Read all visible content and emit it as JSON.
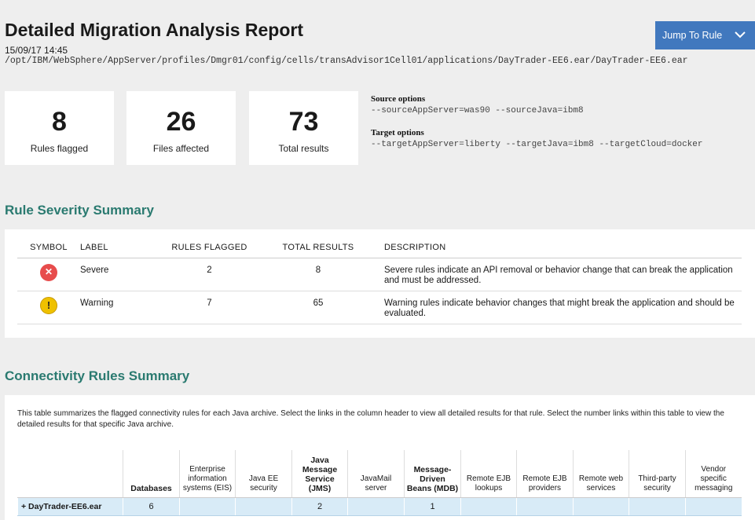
{
  "header": {
    "title": "Detailed Migration Analysis Report",
    "timestamp": "15/09/17 14:45",
    "path": "/opt/IBM/WebSphere/AppServer/profiles/Dmgr01/config/cells/transAdvisor1Cell01/applications/DayTrader-EE6.ear/DayTrader-EE6.ear",
    "jump_button_label": "Jump To Rule"
  },
  "stats": [
    {
      "value": "8",
      "label": "Rules flagged"
    },
    {
      "value": "26",
      "label": "Files affected"
    },
    {
      "value": "73",
      "label": "Total results"
    }
  ],
  "options": {
    "source_header": "Source options",
    "source_value": "--sourceAppServer=was90 --sourceJava=ibm8",
    "target_header": "Target options",
    "target_value": "--targetAppServer=liberty --targetJava=ibm8 --targetCloud=docker"
  },
  "severity_summary": {
    "title": "Rule Severity Summary",
    "columns": [
      "SYMBOL",
      "LABEL",
      "RULES FLAGGED",
      "TOTAL RESULTS",
      "DESCRIPTION"
    ],
    "rows": [
      {
        "symbol": "✕",
        "label": "Severe",
        "rules_flagged": "2",
        "total_results": "8",
        "description": "Severe rules indicate an API removal or behavior change that can break the application and must be addressed."
      },
      {
        "symbol": "!",
        "label": "Warning",
        "rules_flagged": "7",
        "total_results": "65",
        "description": "Warning rules indicate behavior changes that might break the application and should be evaluated."
      }
    ],
    "colors": {
      "severe": "#e74c4c",
      "warning": "#efc100"
    }
  },
  "connectivity_summary": {
    "title": "Connectivity Rules Summary",
    "description": "This table summarizes the flagged connectivity rules for each Java archive. Select the links in the column header to view all detailed results for that rule. Select the number links within this table to view the detailed results for that specific Java archive.",
    "columns": [
      "",
      "Databases",
      "Enterprise information systems (EIS)",
      "Java EE security",
      "Java Message Service (JMS)",
      "JavaMail server",
      "Message-Driven Beans (MDB)",
      "Remote EJB lookups",
      "Remote EJB providers",
      "Remote web services",
      "Third-party security",
      "Vendor specific messaging"
    ],
    "rows": [
      {
        "archive": "+ DayTrader-EE6.ear",
        "values": [
          "6",
          "",
          "",
          "2",
          "",
          "1",
          "",
          "",
          "",
          "",
          ""
        ]
      }
    ]
  },
  "colors": {
    "accent_button": "#4178be",
    "section_title": "#2a7a70",
    "row_highlight": "#d8ebf7"
  }
}
